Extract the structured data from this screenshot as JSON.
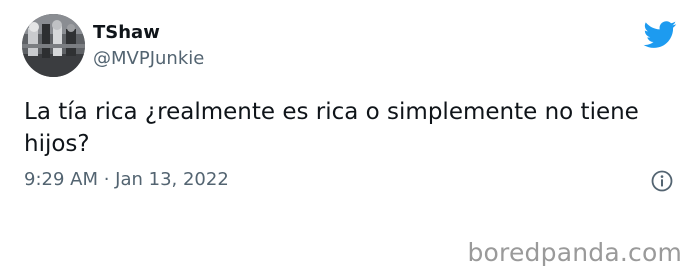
{
  "tweet": {
    "display_name": "TShaw",
    "handle": "@MVPJunkie",
    "text": "La tía rica ¿realmente es rica o simplemente no tiene hijos?",
    "timestamp": "9:29 AM · Jan 13, 2022"
  },
  "icons": {
    "brand": "twitter-bird-icon",
    "info": "info-icon"
  },
  "watermark": {
    "text": "boredpanda.com"
  },
  "colors": {
    "twitter_blue": "#1d9bf0",
    "secondary_text": "#536471",
    "primary_text": "#0f1419",
    "watermark_gray": "#9a9a9a"
  }
}
